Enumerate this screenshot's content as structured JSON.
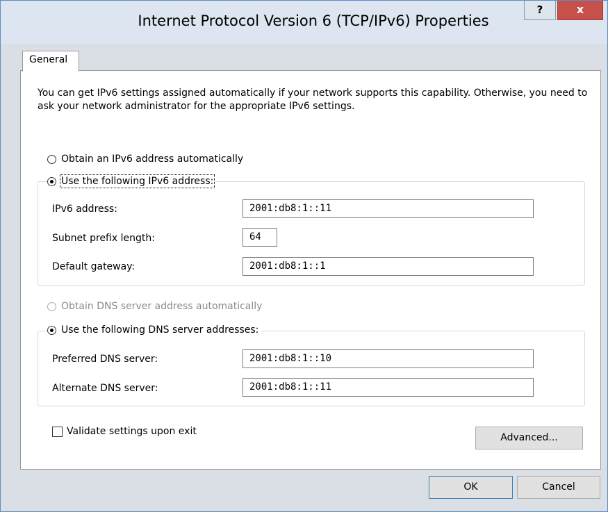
{
  "window": {
    "title": "Internet Protocol Version 6 (TCP/IPv6) Properties",
    "help_label": "?",
    "close_label": "x"
  },
  "tabs": [
    {
      "label": "General"
    }
  ],
  "description": "You can get IPv6 settings assigned automatically if your network supports this capability. Otherwise, you need to ask your network administrator for the appropriate IPv6 settings.",
  "address": {
    "auto_label": "Obtain an IPv6 address automatically",
    "manual_label": "Use the following IPv6 address:",
    "selected": "manual",
    "ipv6_label": "IPv6 address:",
    "ipv6_value": "2001:db8:1::11",
    "prefix_label": "Subnet prefix length:",
    "prefix_value": "64",
    "gateway_label": "Default gateway:",
    "gateway_value": "2001:db8:1::1"
  },
  "dns": {
    "auto_label": "Obtain DNS server address automatically",
    "manual_label": "Use the following DNS server addresses:",
    "selected": "manual",
    "preferred_label": "Preferred DNS server:",
    "preferred_value": "2001:db8:1::10",
    "alternate_label": "Alternate DNS server:",
    "alternate_value": "2001:db8:1::11"
  },
  "validate": {
    "label": "Validate settings upon exit",
    "checked": false
  },
  "buttons": {
    "advanced": "Advanced...",
    "ok": "OK",
    "cancel": "Cancel"
  },
  "colors": {
    "close_button": "#c7504b",
    "titlebar": "#dde6f0",
    "dialog_background": "#dadfe6",
    "default_button_border": "#3c7fb1"
  }
}
